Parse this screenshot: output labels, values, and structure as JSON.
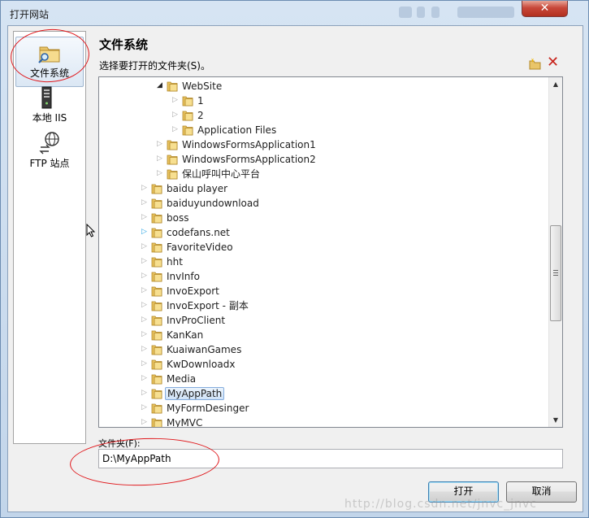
{
  "window": {
    "title": "打开网站",
    "close_glyph": "✕"
  },
  "sidebar": {
    "items": [
      {
        "label": "文件系统",
        "icon": "folder-search-icon",
        "active": true
      },
      {
        "label": "本地 IIS",
        "icon": "server-icon",
        "active": false
      },
      {
        "label": "FTP 站点",
        "icon": "globe-transfer-icon",
        "active": false
      }
    ]
  },
  "main": {
    "heading": "文件系统",
    "subheading": "选择要打开的文件夹(S)。",
    "toolbar": {
      "new_folder_icon": "new-folder-icon",
      "delete_icon": "delete-icon",
      "delete_glyph": "✕",
      "delete_color": "#c8231b"
    }
  },
  "tree": {
    "items": [
      {
        "label": "WebSite",
        "expander": "expanded",
        "level": 4
      },
      {
        "label": "1",
        "expander": "collapsed",
        "level": 5
      },
      {
        "label": "2",
        "expander": "collapsed",
        "level": 5
      },
      {
        "label": "Application Files",
        "expander": "collapsed",
        "level": 5
      },
      {
        "label": "WindowsFormsApplication1",
        "expander": "collapsed",
        "level": 4
      },
      {
        "label": "WindowsFormsApplication2",
        "expander": "collapsed",
        "level": 4
      },
      {
        "label": "保山呼叫中心平台",
        "expander": "collapsed",
        "level": 4
      },
      {
        "label": "baidu player",
        "expander": "collapsed",
        "level": 3
      },
      {
        "label": "baiduyundownload",
        "expander": "collapsed",
        "level": 3
      },
      {
        "label": "boss",
        "expander": "collapsed",
        "level": 3
      },
      {
        "label": "codefans.net",
        "expander": "hover",
        "level": 3
      },
      {
        "label": "FavoriteVideo",
        "expander": "collapsed",
        "level": 3
      },
      {
        "label": "hht",
        "expander": "collapsed",
        "level": 3
      },
      {
        "label": "InvInfo",
        "expander": "collapsed",
        "level": 3
      },
      {
        "label": "InvoExport",
        "expander": "collapsed",
        "level": 3
      },
      {
        "label": "InvoExport - 副本",
        "expander": "collapsed",
        "level": 3
      },
      {
        "label": "InvProClient",
        "expander": "collapsed",
        "level": 3
      },
      {
        "label": "KanKan",
        "expander": "collapsed",
        "level": 3
      },
      {
        "label": "KuaiwanGames",
        "expander": "collapsed",
        "level": 3
      },
      {
        "label": "KwDownloadx",
        "expander": "collapsed",
        "level": 3
      },
      {
        "label": "Media",
        "expander": "collapsed",
        "level": 3
      },
      {
        "label": "MyAppPath",
        "expander": "collapsed",
        "level": 3,
        "selected": true
      },
      {
        "label": "MyFormDesinger",
        "expander": "collapsed",
        "level": 3
      },
      {
        "label": "MyMVC",
        "expander": "collapsed",
        "level": 3
      }
    ]
  },
  "folder_field": {
    "label": "文件夹(F):",
    "value": "D:\\MyAppPath"
  },
  "buttons": {
    "ok": "打开",
    "cancel": "取消"
  },
  "annotation_color": "#e0181c",
  "watermark": "http://blog.csdn.net/jnvc_jnvc"
}
